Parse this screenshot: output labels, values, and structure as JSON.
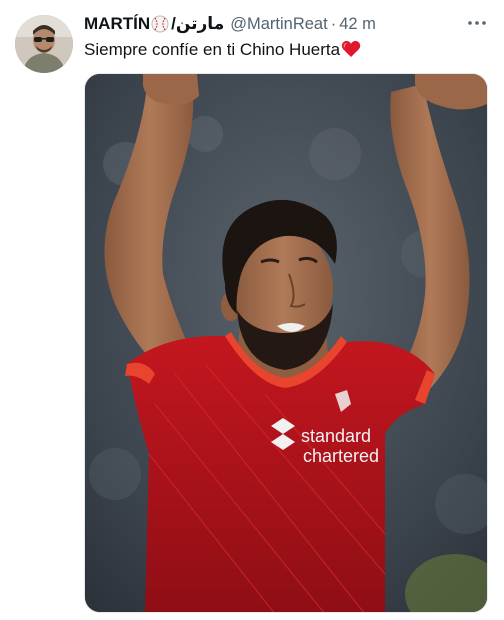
{
  "tweet": {
    "display_name": "MARTÍN",
    "display_name_suffix": "/مارتن",
    "handle": "@MartinReat",
    "separator": "·",
    "time": "42 m",
    "text": "Siempre confíe en ti Chino Huerta",
    "media": {
      "shirt_sponsor_line1": "standard",
      "shirt_sponsor_line2": "chartered"
    }
  },
  "icons": {
    "name_emoji": "baseball-icon",
    "text_emoji": "red-heart-icon",
    "menu": "more-horizontal-icon"
  },
  "colors": {
    "text_primary": "#0f1419",
    "text_secondary": "#536471",
    "heart": "#e0182d",
    "shirt_red": "#b3121b"
  }
}
